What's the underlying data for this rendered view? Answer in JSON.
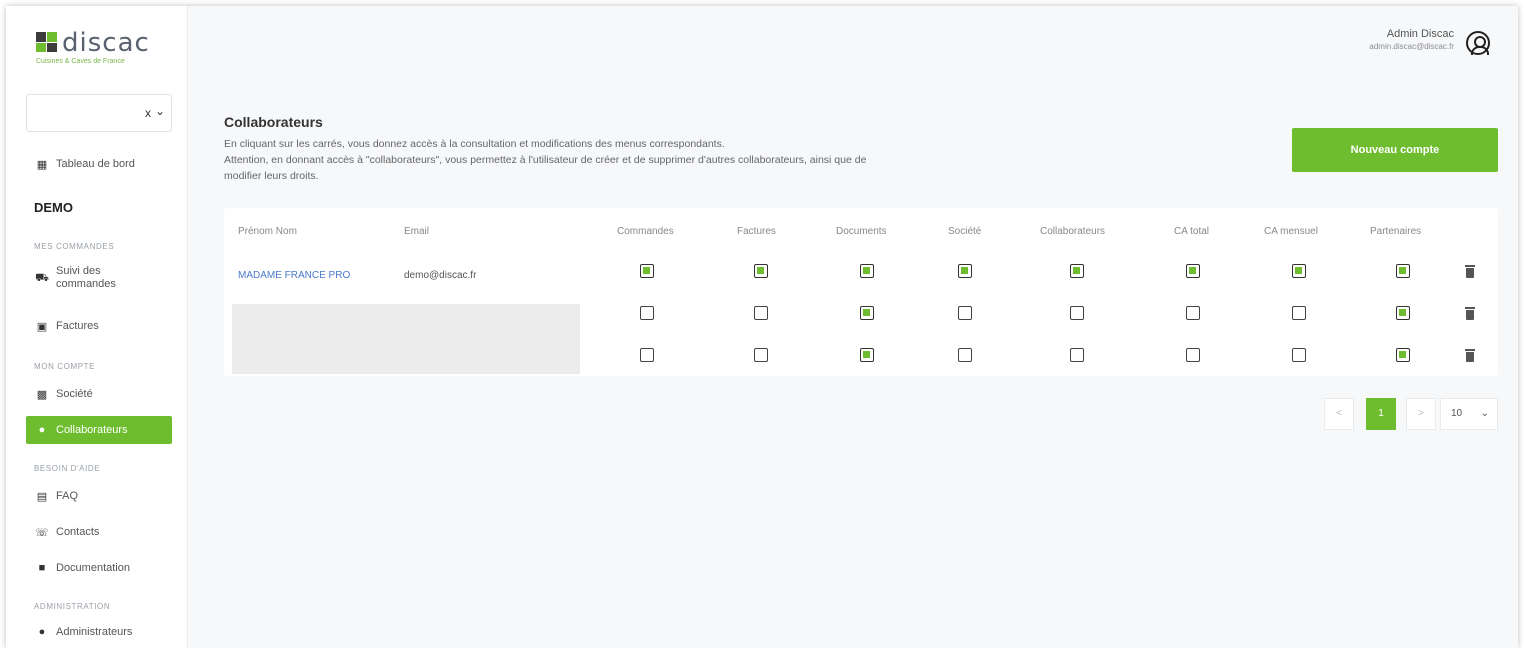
{
  "brand": {
    "name": "discac",
    "tagline": "Cuisines & Caves de France",
    "accent": "#6ebd2f"
  },
  "sidebar": {
    "company_select": {
      "value": "",
      "clear": "x",
      "chevron": "chevron-down-icon"
    },
    "dashboard": "Tableau de bord",
    "client_name": "DEMO",
    "sections": {
      "orders": "MES COMMANDES",
      "account": "MON COMPTE",
      "help": "BESOIN D'AIDE",
      "admin": "ADMINISTRATION"
    },
    "items": {
      "orders_tracking": "Suivi des commandes",
      "invoices": "Factures",
      "company": "Société",
      "collaborators": "Collaborateurs",
      "faq": "FAQ",
      "contacts": "Contacts",
      "documentation": "Documentation",
      "administrators": "Administrateurs"
    }
  },
  "header": {
    "user_name": "Admin Discac",
    "user_email": "admin.discac@discac.fr"
  },
  "main": {
    "title": "Collaborateurs",
    "desc_line1": "En cliquant sur les carrés, vous donnez accès à la consultation et modifications des menus correspondants.",
    "desc_line2": "Attention, en donnant accès à \"collaborateurs\", vous permettez à l'utilisateur de créer et de supprimer d'autres collaborateurs, ainsi que de",
    "desc_line3": "modifier leurs droits.",
    "new_account_button": "Nouveau compte"
  },
  "table": {
    "headers": {
      "name": "Prénom Nom",
      "email": "Email",
      "orders": "Commandes",
      "invoices": "Factures",
      "documents": "Documents",
      "company": "Société",
      "collaborators": "Collaborateurs",
      "ca_total": "CA total",
      "ca_monthly": "CA mensuel",
      "partners": "Partenaires"
    },
    "rows": [
      {
        "name": "MADAME FRANCE PRO",
        "email": "demo@discac.fr",
        "permissions": [
          true,
          true,
          true,
          true,
          true,
          true,
          true,
          true
        ]
      },
      {
        "name": "",
        "email": "",
        "permissions": [
          false,
          false,
          true,
          false,
          false,
          false,
          false,
          true
        ]
      },
      {
        "name": "",
        "email": "",
        "permissions": [
          false,
          false,
          true,
          false,
          false,
          false,
          false,
          true
        ]
      }
    ]
  },
  "pagination": {
    "prev": "<",
    "current_page": "1",
    "next": ">",
    "per_page": "10"
  }
}
